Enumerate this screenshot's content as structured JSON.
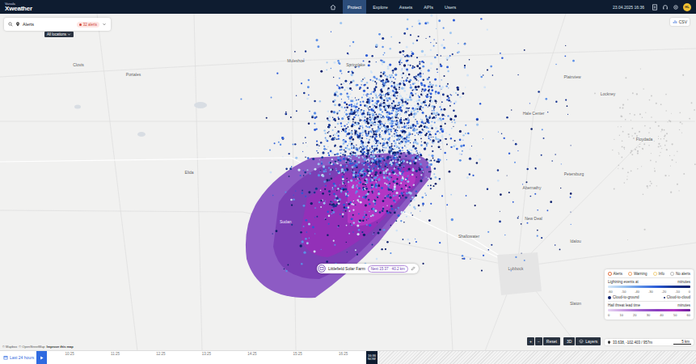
{
  "header": {
    "brand_small": "Vaisala",
    "brand": "Xweather",
    "nav": [
      {
        "label": "Protect",
        "selected": true
      },
      {
        "label": "Explore",
        "selected": false
      },
      {
        "label": "Assets",
        "selected": false
      },
      {
        "label": "APIs",
        "selected": false
      },
      {
        "label": "Users",
        "selected": false
      }
    ],
    "datetime": "23.04.2025 16:36",
    "avatar": "HL"
  },
  "search": {
    "label": "Alerts",
    "badge": "32 alerts",
    "filter": "All locations"
  },
  "export_button": "CSV",
  "map": {
    "places": [
      "Clovis",
      "Portales",
      "Elida",
      "Muleshoe",
      "Springlake",
      "Plainview",
      "Lockney",
      "Hale Center",
      "Floydada",
      "Petersburg",
      "Abernathy",
      "New Deal",
      "Shallowater",
      "Idalou",
      "Lubbock",
      "Slaton"
    ],
    "area_label": "Sudan",
    "asset": {
      "name": "Littlefield Solar Farm",
      "info": "Next 15:37 · 40.2 km"
    },
    "attribution": [
      "© Mapbox",
      "© OpenStreetMap",
      "Improve this map"
    ]
  },
  "legend": {
    "alert_levels": [
      {
        "label": "Alerts",
        "color": "#e0662f"
      },
      {
        "label": "Warning",
        "color": "#f0a060"
      },
      {
        "label": "Info",
        "color": "#f2cf7a"
      },
      {
        "label": "No alerts",
        "color": "#b8b8b8"
      }
    ],
    "lightning": {
      "title": "Lightning events at",
      "unit": "minutes",
      "ticks": [
        "-60",
        "-50",
        "-40",
        "-30",
        "-20",
        "-10",
        "0"
      ],
      "types": [
        "Cloud-to-ground",
        "Cloud-to-cloud"
      ]
    },
    "hail": {
      "title": "Hail threat lead time",
      "unit": "minutes",
      "ticks": [
        "0",
        "10",
        "20",
        "30",
        "40",
        "50",
        "60"
      ]
    }
  },
  "map_controls": {
    "zoom_in": "+",
    "zoom_out": "−",
    "reset": "Reset",
    "view": "3D",
    "layers": "Layers",
    "coordinates": "33.638, -102.403 / 957m",
    "scale": "5 km"
  },
  "timeline": {
    "range": "Last 24 hours",
    "times": [
      "10:25",
      "11:25",
      "12:25",
      "13:25",
      "14:25",
      "15:25",
      "16:25"
    ],
    "now_time": "16:36",
    "now_label": "NOW"
  }
}
